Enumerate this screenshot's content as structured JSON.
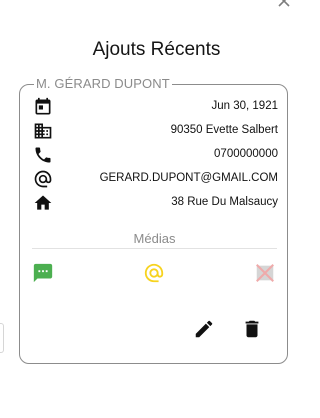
{
  "header": {
    "title": "Ajouts Récents"
  },
  "contact": {
    "name": "M. GÉRARD DUPONT",
    "birth_date": "Jun 30, 1921",
    "city": "90350 Evette Salbert",
    "phone": "0700000000",
    "email": "GERARD.DUPONT@GMAIL.COM",
    "address": "38 Rue Du Malsaucy"
  },
  "media": {
    "label": "Médias"
  },
  "icons": {
    "close": "close-icon",
    "calendar": "calendar-icon",
    "building": "building-icon",
    "phone": "phone-icon",
    "email": "at-sign-icon",
    "home": "home-icon",
    "sms": "sms-icon",
    "mail": "at-sign-icon",
    "no_video": "crossed-out-icon",
    "edit": "pencil-icon",
    "delete": "trash-icon"
  },
  "colors": {
    "sms_green": "#4caf50",
    "mail_yellow": "#f7d31f",
    "disabled_pink": "#efaaaa"
  }
}
